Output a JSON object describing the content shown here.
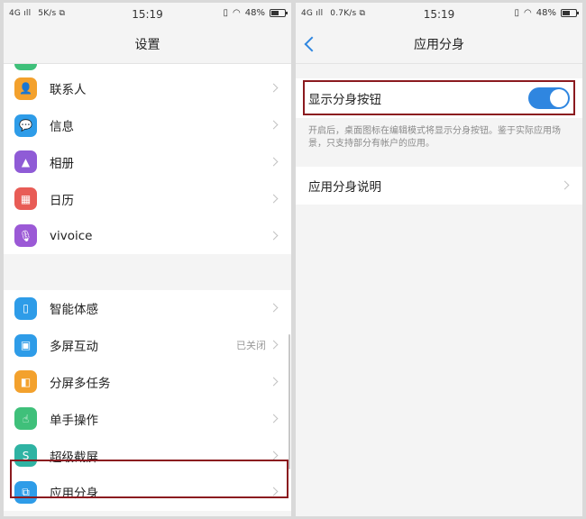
{
  "left": {
    "status": {
      "network": "4G",
      "speed": "5K/s",
      "time": "15:19",
      "battery": "48%"
    },
    "title": "设置",
    "group1": [
      {
        "label": "联系人",
        "icon": "contact-icon",
        "color": "#f3a12d",
        "glyph": "👤"
      },
      {
        "label": "信息",
        "icon": "message-icon",
        "color": "#2e9ce8",
        "glyph": "💬"
      },
      {
        "label": "相册",
        "icon": "gallery-icon",
        "color": "#8f5bd6",
        "glyph": "▲"
      },
      {
        "label": "日历",
        "icon": "calendar-icon",
        "color": "#e85c56",
        "glyph": "▦"
      },
      {
        "label": "vivoice",
        "icon": "microphone-icon",
        "color": "#9b59d6",
        "glyph": "🎙"
      }
    ],
    "group2": [
      {
        "label": "智能体感",
        "icon": "motion-icon",
        "color": "#2e9ce8",
        "glyph": "▯",
        "value": ""
      },
      {
        "label": "多屏互动",
        "icon": "multiscreen-icon",
        "color": "#2e9ce8",
        "glyph": "▣",
        "value": "已关闭"
      },
      {
        "label": "分屏多任务",
        "icon": "splitscreen-icon",
        "color": "#f3a12d",
        "glyph": "◧",
        "value": ""
      },
      {
        "label": "单手操作",
        "icon": "one-hand-icon",
        "color": "#3fc07a",
        "glyph": "☝",
        "value": ""
      },
      {
        "label": "超级截屏",
        "icon": "screenshot-icon",
        "color": "#2fb3a3",
        "glyph": "S",
        "value": ""
      },
      {
        "label": "应用分身",
        "icon": "app-clone-icon",
        "color": "#2e9ce8",
        "glyph": "⧉",
        "value": ""
      }
    ]
  },
  "right": {
    "status": {
      "network": "4G",
      "speed": "0.7K/s",
      "time": "15:19",
      "battery": "48%"
    },
    "title": "应用分身",
    "toggle_label": "显示分身按钮",
    "toggle_on": true,
    "description": "开启后，桌面图标在编辑模式将显示分身按钮。鉴于实际应用场景，只支持部分有帐户的应用。",
    "item_label": "应用分身说明"
  },
  "colors": {
    "accent": "#2f86e0",
    "highlight": "#8b1a1f"
  }
}
